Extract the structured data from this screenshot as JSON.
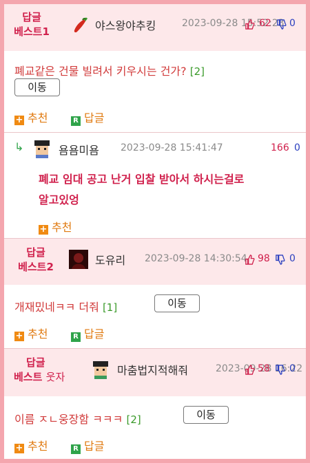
{
  "posts": [
    {
      "best_label": "답글",
      "best_rank": "베스트1",
      "nickname": "야스왕야추킹",
      "date": "2023-09-28 15:52:23",
      "likes": "62",
      "dislikes": "0",
      "body": "폐교같은 건물 빌려서 키우시는 건가?",
      "reply_count": "[2]",
      "move_label": "이동",
      "recommend_label": "추천",
      "reply_label": "답글"
    },
    {
      "best_label": "답글",
      "best_rank": "베스트2",
      "nickname": "도유리",
      "date": "2023-09-28 14:30:54",
      "likes": "98",
      "dislikes": "0",
      "body": "개재밌네ㅋㅋ 더줘",
      "reply_count": "[1]",
      "move_label": "이동",
      "recommend_label": "추천",
      "reply_label": "답글"
    },
    {
      "best_label": "답글",
      "best_rank": "베스트",
      "best_tag": "웃자",
      "nickname": "마춤법지적해줘",
      "date": "2023-09-28 16:22",
      "likes": "58",
      "dislikes": "0",
      "body": "이름 ㅈㄴ웅장함 ㅋㅋㅋ",
      "reply_count": "[2]",
      "move_label": "이동",
      "recommend_label": "추천",
      "reply_label": "답글"
    }
  ],
  "reply": {
    "arrow": "↳",
    "nickname": "욤욤미욤",
    "date": "2023-09-28 15:41:47",
    "likes": "166",
    "dislikes": "0",
    "text_line1": "폐교 임대 공고 난거 입찰 받아서 하시는걸로",
    "text_line2": "알고있엉",
    "recommend_label": "추천"
  },
  "icons": {
    "recommend": "plus-icon",
    "reply": "reply-r-icon",
    "like": "thumbs-up-icon",
    "dislike": "thumbs-down-icon"
  },
  "colors": {
    "border": "#f4a6ae",
    "header_bg": "#fde8ea",
    "best_red": "#d0204c",
    "body_red": "#d13a3a",
    "dislike_blue": "#2a3fbf",
    "action_orange": "#e07a10",
    "count_green": "#3a9a2a"
  }
}
